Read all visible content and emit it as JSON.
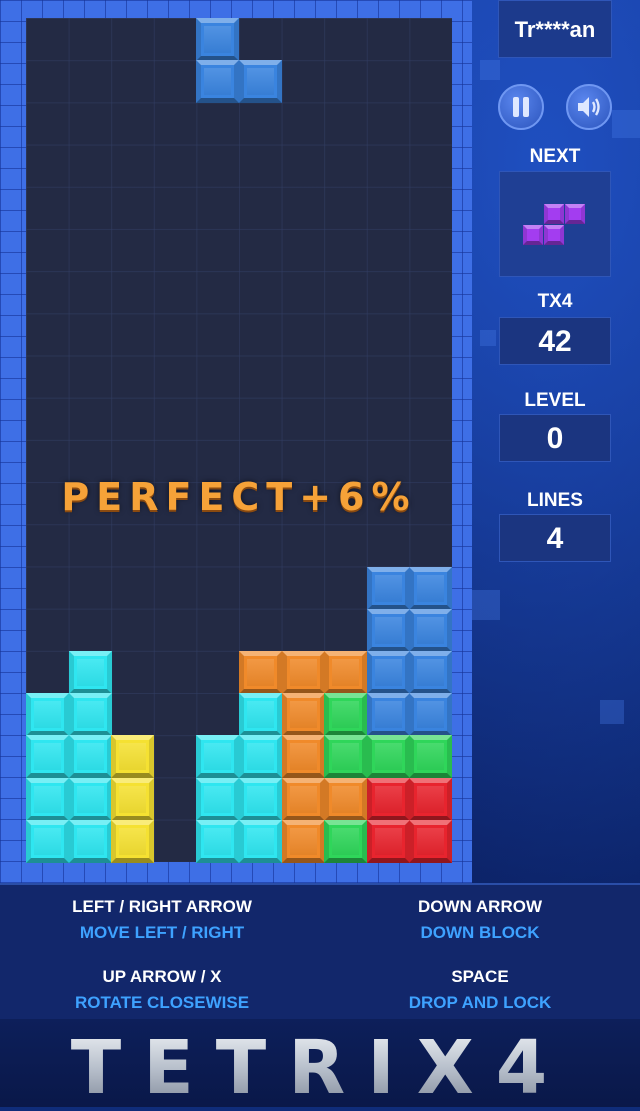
{
  "player": {
    "name": "Tr****an"
  },
  "panel": {
    "next_label": "NEXT",
    "score_label": "TX4",
    "score_value": "42",
    "level_label": "LEVEL",
    "level_value": "0",
    "lines_label": "LINES",
    "lines_value": "4"
  },
  "buttons": {
    "pause_icon": "pause-icon",
    "sound_icon": "speaker-icon"
  },
  "overlay": {
    "message": "PERFECT+6%"
  },
  "controls": [
    {
      "key": "LEFT /  RIGHT  ARROW",
      "action": "MOVE LEFT / RIGHT"
    },
    {
      "key": "DOWN ARROW",
      "action": "DOWN BLOCK"
    },
    {
      "key": "UP ARROW / X",
      "action": "ROTATE CLOSEWISE"
    },
    {
      "key": "SPACE",
      "action": "DROP AND LOCK"
    }
  ],
  "logo": {
    "text": "TETRIX4"
  },
  "colors": {
    "cyan": "#2fe6f0",
    "yellow": "#f5e132",
    "orange": "#f08a2a",
    "green": "#2fd65a",
    "blue": "#3a84df",
    "red": "#e8242e",
    "purple": "#a33df0"
  },
  "board": {
    "cols": 10,
    "rows": 20,
    "active_piece": {
      "color": "blue",
      "cells": [
        [
          4,
          0
        ],
        [
          4,
          1
        ],
        [
          5,
          1
        ]
      ]
    },
    "locked_cells": [
      [
        9,
        13,
        "blue"
      ],
      [
        8,
        13,
        "blue"
      ],
      [
        9,
        14,
        "blue"
      ],
      [
        8,
        14,
        "blue"
      ],
      [
        1,
        15,
        "cyan"
      ],
      [
        5,
        15,
        "orange"
      ],
      [
        6,
        15,
        "orange"
      ],
      [
        7,
        15,
        "orange"
      ],
      [
        8,
        15,
        "blue"
      ],
      [
        9,
        15,
        "blue"
      ],
      [
        0,
        16,
        "cyan"
      ],
      [
        1,
        16,
        "cyan"
      ],
      [
        5,
        16,
        "cyan"
      ],
      [
        6,
        16,
        "orange"
      ],
      [
        7,
        16,
        "green"
      ],
      [
        8,
        16,
        "blue"
      ],
      [
        9,
        16,
        "blue"
      ],
      [
        0,
        17,
        "cyan"
      ],
      [
        1,
        17,
        "cyan"
      ],
      [
        2,
        17,
        "yellow"
      ],
      [
        4,
        17,
        "cyan"
      ],
      [
        5,
        17,
        "cyan"
      ],
      [
        6,
        17,
        "orange"
      ],
      [
        7,
        17,
        "green"
      ],
      [
        8,
        17,
        "green"
      ],
      [
        9,
        17,
        "green"
      ],
      [
        0,
        18,
        "cyan"
      ],
      [
        1,
        18,
        "cyan"
      ],
      [
        2,
        18,
        "yellow"
      ],
      [
        4,
        18,
        "cyan"
      ],
      [
        5,
        18,
        "cyan"
      ],
      [
        6,
        18,
        "orange"
      ],
      [
        7,
        18,
        "orange"
      ],
      [
        8,
        18,
        "red"
      ],
      [
        9,
        18,
        "red"
      ],
      [
        0,
        19,
        "cyan"
      ],
      [
        1,
        19,
        "cyan"
      ],
      [
        2,
        19,
        "yellow"
      ],
      [
        4,
        19,
        "cyan"
      ],
      [
        5,
        19,
        "cyan"
      ],
      [
        6,
        19,
        "orange"
      ],
      [
        7,
        19,
        "green"
      ],
      [
        8,
        19,
        "red"
      ],
      [
        9,
        19,
        "red"
      ]
    ],
    "next_piece": {
      "color": "purple",
      "cells": [
        [
          1,
          0
        ],
        [
          2,
          0
        ],
        [
          0,
          1
        ],
        [
          1,
          1
        ]
      ]
    }
  }
}
